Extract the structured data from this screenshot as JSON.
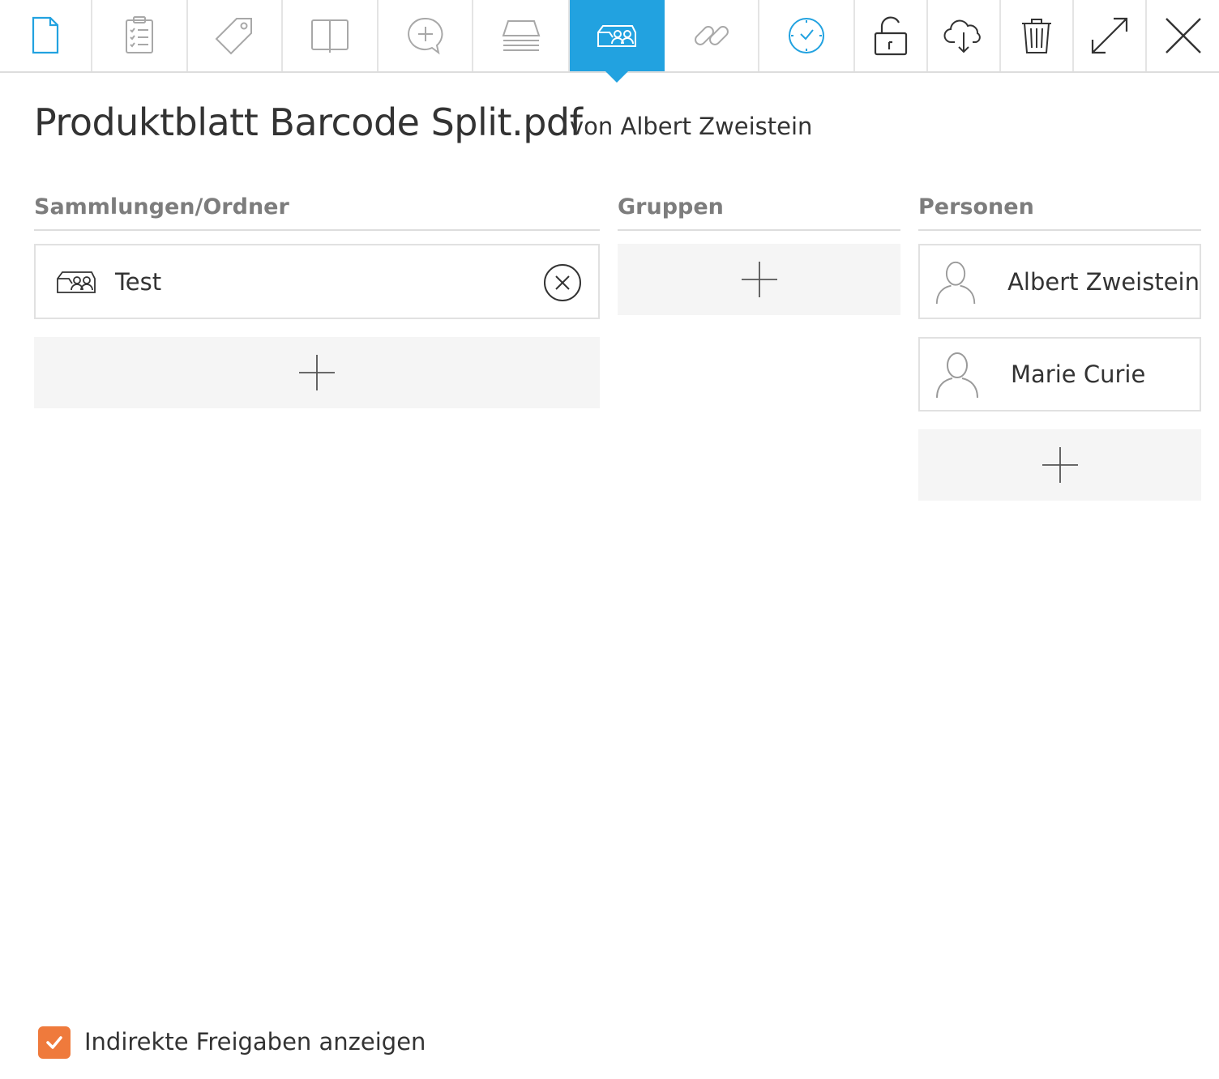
{
  "toolbar": {
    "tabs": [
      {
        "name": "document-icon",
        "active": false
      },
      {
        "name": "clipboard-list-icon",
        "active": false
      },
      {
        "name": "tag-icon",
        "active": false
      },
      {
        "name": "book-icon",
        "active": false
      },
      {
        "name": "add-comment-icon",
        "active": false
      },
      {
        "name": "tray-stack-icon",
        "active": false
      },
      {
        "name": "share-folder-icon",
        "active": true
      },
      {
        "name": "link-icon",
        "active": false
      },
      {
        "name": "clock-icon",
        "active": false
      }
    ],
    "actions": [
      "unlock-icon",
      "cloud-download-icon",
      "trash-icon",
      "expand-icon",
      "close-icon"
    ],
    "colors": {
      "active": "#22a2e0",
      "icon": "#aaaaaa",
      "icon_accent": "#22a2e0",
      "action": "#333333"
    }
  },
  "document": {
    "title": "Produktblatt Barcode Split.pdf",
    "owner": "von Albert Zweistein"
  },
  "collections": {
    "heading": "Sammlungen/Ordner",
    "items": [
      {
        "label": "Test",
        "icon": "share-folder-icon"
      }
    ]
  },
  "groups": {
    "heading": "Gruppen",
    "items": []
  },
  "persons": {
    "heading": "Personen",
    "items": [
      {
        "label": "Albert Zweistein",
        "icon": "user-icon"
      },
      {
        "label": "Marie Curie",
        "icon": "user-icon"
      }
    ]
  },
  "footer": {
    "show_indirect_label": "Indirekte Freigaben anzeigen",
    "show_indirect_checked": true,
    "checkbox_color": "#ef7a3c"
  }
}
